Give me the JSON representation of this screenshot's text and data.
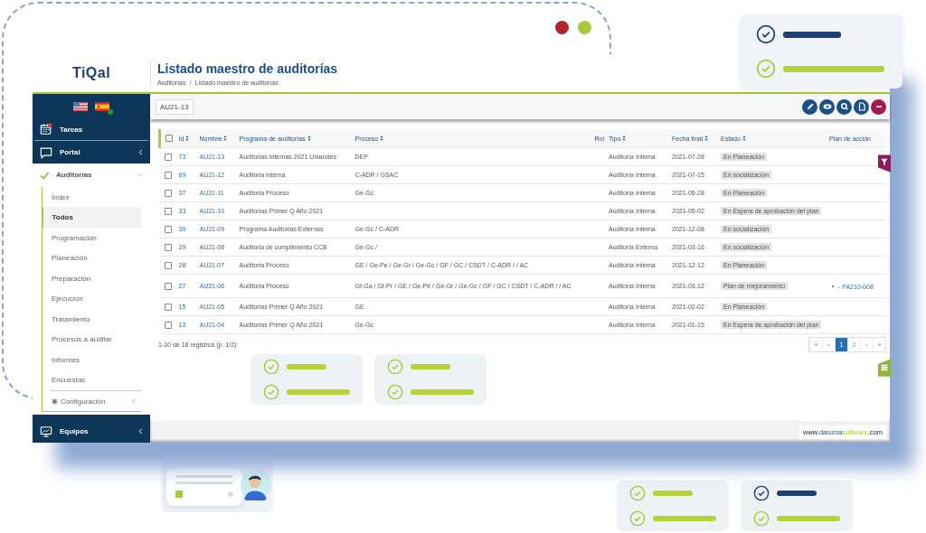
{
  "app": {
    "logo": "TiQal",
    "title": "Listado maestro de auditorías",
    "breadcrumb": [
      "Auditorías",
      "Listado maestro de auditorías"
    ],
    "breadcrumb_separator": "/"
  },
  "languages": [
    {
      "selected": false
    },
    {
      "selected": true
    }
  ],
  "sidebar": {
    "top": [
      {
        "label": "Tareas"
      },
      {
        "label": "Portal"
      }
    ],
    "section": {
      "label": "Auditorías",
      "expanded": true,
      "items": [
        {
          "label": "Índex",
          "selected": false
        },
        {
          "label": "Todos",
          "selected": true
        },
        {
          "label": "Programación",
          "selected": false
        },
        {
          "label": "Planeación",
          "selected": false
        },
        {
          "label": "Preparación",
          "selected": false
        },
        {
          "label": "Ejecución",
          "selected": false
        },
        {
          "label": "Tratamiento",
          "selected": false
        },
        {
          "label": "Procesos a auditar",
          "selected": false
        },
        {
          "label": "Informes",
          "selected": false
        },
        {
          "label": "Encuestas",
          "selected": false
        }
      ],
      "config": "Configuración"
    },
    "bottom": {
      "label": "Equipos"
    }
  },
  "toolbar": {
    "chip": "AU21-13",
    "actions": [
      {
        "kind": "edit"
      },
      {
        "kind": "view"
      },
      {
        "kind": "search"
      },
      {
        "kind": "document"
      },
      {
        "kind": "remove"
      }
    ]
  },
  "table": {
    "select_all_checked": false,
    "columns": [
      {
        "label": "Id",
        "sortable": true
      },
      {
        "label": "Nombre",
        "sortable": true
      },
      {
        "label": "Programa de auditorías",
        "sortable": true
      },
      {
        "label": "Proceso",
        "sortable": true
      },
      {
        "label": "Rol",
        "sortable": false
      },
      {
        "label": "Tipo",
        "sortable": true
      },
      {
        "label": "Fecha final",
        "sortable": true
      },
      {
        "label": "Estado",
        "sortable": true
      },
      {
        "label": "Plan de acción",
        "sortable": false
      }
    ],
    "rows": [
      {
        "checked": false,
        "id": "73",
        "nombre": "AU21-13",
        "programa": "Auditorias Internas 2021 Uniandes",
        "proceso": "DEP",
        "tipo": "Auditoría Interna",
        "fecha": "2021-07-28",
        "estado": "En Planeación"
      },
      {
        "checked": false,
        "id": "69",
        "nombre": "AU21-12",
        "programa": "Auditoria interna",
        "proceso": "C-ADR / GSAC",
        "tipo": "Auditoría Interna",
        "fecha": "2021-07-15",
        "estado": "En socialización"
      },
      {
        "checked": false,
        "id": "37",
        "nombre": "AU21-11",
        "programa": "Auditoria Proceso",
        "proceso": "Ge-Gc",
        "tipo": "Auditoría Interna",
        "fecha": "2021-05-28",
        "estado": "En Planeación"
      },
      {
        "checked": false,
        "id": "33",
        "nombre": "AU21-10",
        "programa": "Auditorias Primer Q Año 2021",
        "tipo": "Auditoría Interna",
        "fecha": "2021-05-02",
        "estado": "En Espera de aprobación del plan"
      },
      {
        "checked": false,
        "id": "30",
        "nombre": "AU21-09",
        "programa": "Programa Auditorias Externas",
        "proceso": "Ge-Gc / C-ADR",
        "tipo": "Auditoría Interna",
        "fecha": "2021-12-08",
        "estado": "En socialización"
      },
      {
        "checked": false,
        "id": "29",
        "nombre": "AU21-08",
        "programa": "Auditoria de cumplimiento CCB",
        "proceso": "Ge-Gc /",
        "tipo": "Auditoría Externa",
        "fecha": "2021-03-16",
        "estado": "En socialización"
      },
      {
        "checked": false,
        "id": "28",
        "nombre": "AU21-07",
        "programa": "Auditoria Proceso",
        "proceso": "GE / Ge-Pe / Ge-Gr / Ge-Gc / GF / GC / CSDT / C-ADR / / AC",
        "tipo": "Auditoría Interna",
        "fecha": "2021-12-12",
        "estado": "En Planeación"
      },
      {
        "checked": false,
        "id": "27",
        "nombre": "AU21-06",
        "programa": "Auditoria Proceso",
        "proceso": "Gf-Ga / Gf-Pr / GE / Ge-Pe / Ge-Gr / Ge-Gc / GF / GC / CSDT / C-ADR / / AC",
        "tipo": "Auditoría Interna",
        "fecha": "2021-03-12",
        "estado": "Plan de mejoramiento",
        "plan": "- PA210-008"
      },
      {
        "checked": false,
        "id": "15",
        "nombre": "AU21-05",
        "programa": "Auditorias Primer Q Año 2021",
        "proceso": "GE",
        "tipo": "Auditoría Interna",
        "fecha": "2021-02-02",
        "estado": "En Planeación"
      },
      {
        "checked": false,
        "id": "13",
        "nombre": "AU21-04",
        "programa": "Auditorias Primer Q Año 2021",
        "proceso": "Ge-Gc",
        "tipo": "Auditoría Interna",
        "fecha": "2021-01-15",
        "estado": "En Espera de aprobación del plan"
      }
    ],
    "summary": "1-10 de 18 registros (p. 1/2)"
  },
  "pagination": [
    {
      "label": "«",
      "selected": false
    },
    {
      "label": "‹",
      "selected": false
    },
    {
      "label": "1",
      "selected": true
    },
    {
      "label": "2",
      "selected": false
    },
    {
      "label": "›",
      "selected": false
    },
    {
      "label": "»",
      "selected": false
    }
  ],
  "footer": {
    "www": "www.",
    "brand1": "daruma",
    "brand2": "software",
    "tld": ".com"
  }
}
